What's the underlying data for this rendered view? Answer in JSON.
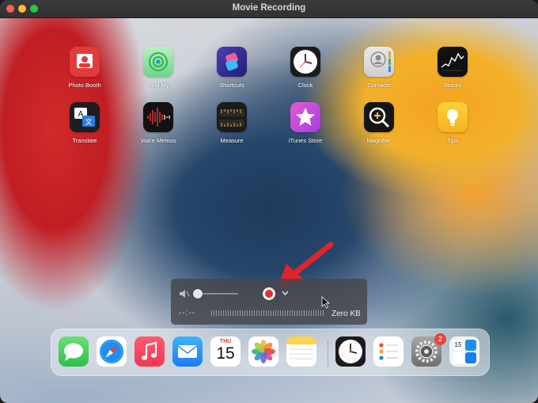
{
  "window": {
    "title": "Movie Recording"
  },
  "apps": [
    {
      "label": "Photo Booth",
      "icon": "photo-booth-icon"
    },
    {
      "label": "Find My",
      "icon": "find-my-icon"
    },
    {
      "label": "Shortcuts",
      "icon": "shortcuts-icon"
    },
    {
      "label": "Clock",
      "icon": "clock-icon"
    },
    {
      "label": "Contacts",
      "icon": "contacts-icon"
    },
    {
      "label": "Stocks",
      "icon": "stocks-icon"
    },
    {
      "label": "Translate",
      "icon": "translate-icon"
    },
    {
      "label": "Voice Memos",
      "icon": "voice-memos-icon"
    },
    {
      "label": "Measure",
      "icon": "measure-icon"
    },
    {
      "label": "iTunes Store",
      "icon": "itunes-store-icon"
    },
    {
      "label": "Magnifier",
      "icon": "magnifier-icon"
    },
    {
      "label": "Tips",
      "icon": "tips-icon"
    }
  ],
  "recording": {
    "time": "--:--",
    "size": "Zero KB",
    "volume_percent": 0
  },
  "dock": {
    "calendar_day": "THU",
    "calendar_date": "15",
    "settings_badge": "2",
    "mini_calendar_date": "15"
  },
  "colors": {
    "record_red": "#e2302a",
    "arrow_red": "#e0242a"
  }
}
